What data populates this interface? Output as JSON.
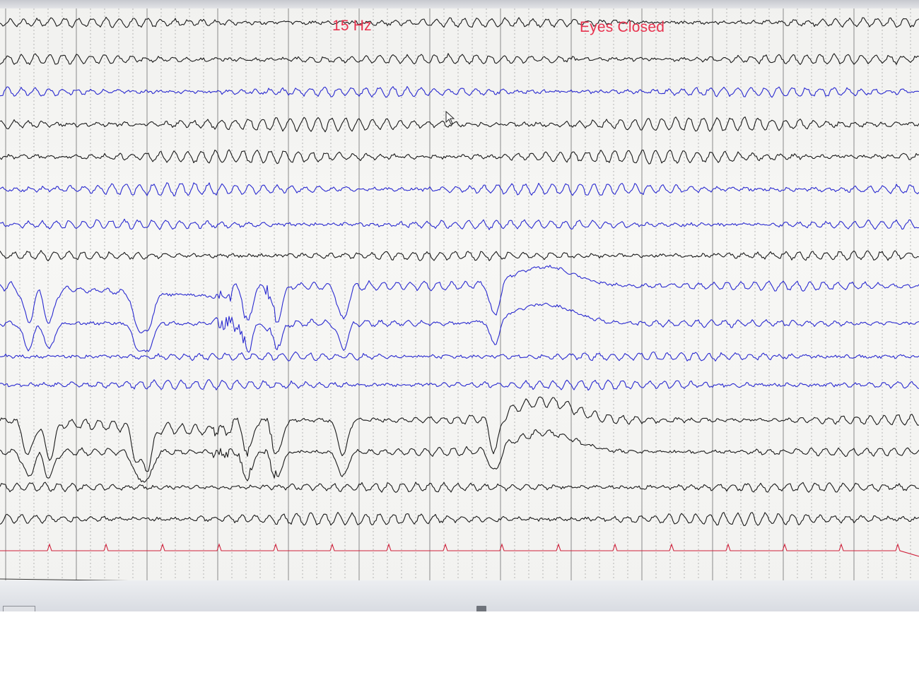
{
  "annotations": {
    "frequency": "15 Hz",
    "state": "Eyes Closed"
  },
  "colors": {
    "background": "#f4f4f2",
    "grid": "#8a8a8a",
    "trace_black": "#1a1a1a",
    "trace_blue": "#2a2ad0",
    "annotation": "#e8334f",
    "ecg_marker": "#d0203a"
  },
  "channels": [
    {
      "color": "black",
      "style": "alpha"
    },
    {
      "color": "black",
      "style": "alpha"
    },
    {
      "color": "blue",
      "style": "alpha"
    },
    {
      "color": "black",
      "style": "alpha"
    },
    {
      "color": "black",
      "style": "alpha"
    },
    {
      "color": "blue",
      "style": "alpha"
    },
    {
      "color": "blue",
      "style": "alpha"
    },
    {
      "color": "black",
      "style": "alpha"
    },
    {
      "color": "blue",
      "style": "eye-movement"
    },
    {
      "color": "blue",
      "style": "eye-movement"
    },
    {
      "color": "blue",
      "style": "alpha"
    },
    {
      "color": "blue",
      "style": "alpha"
    },
    {
      "color": "black",
      "style": "eye-movement"
    },
    {
      "color": "black",
      "style": "eye-movement"
    },
    {
      "color": "black",
      "style": "alpha"
    },
    {
      "color": "black",
      "style": "alpha"
    }
  ],
  "ecg_channel": {
    "label": "ECG",
    "color": "red"
  },
  "cursor_icon": "pointer-arrow-icon"
}
